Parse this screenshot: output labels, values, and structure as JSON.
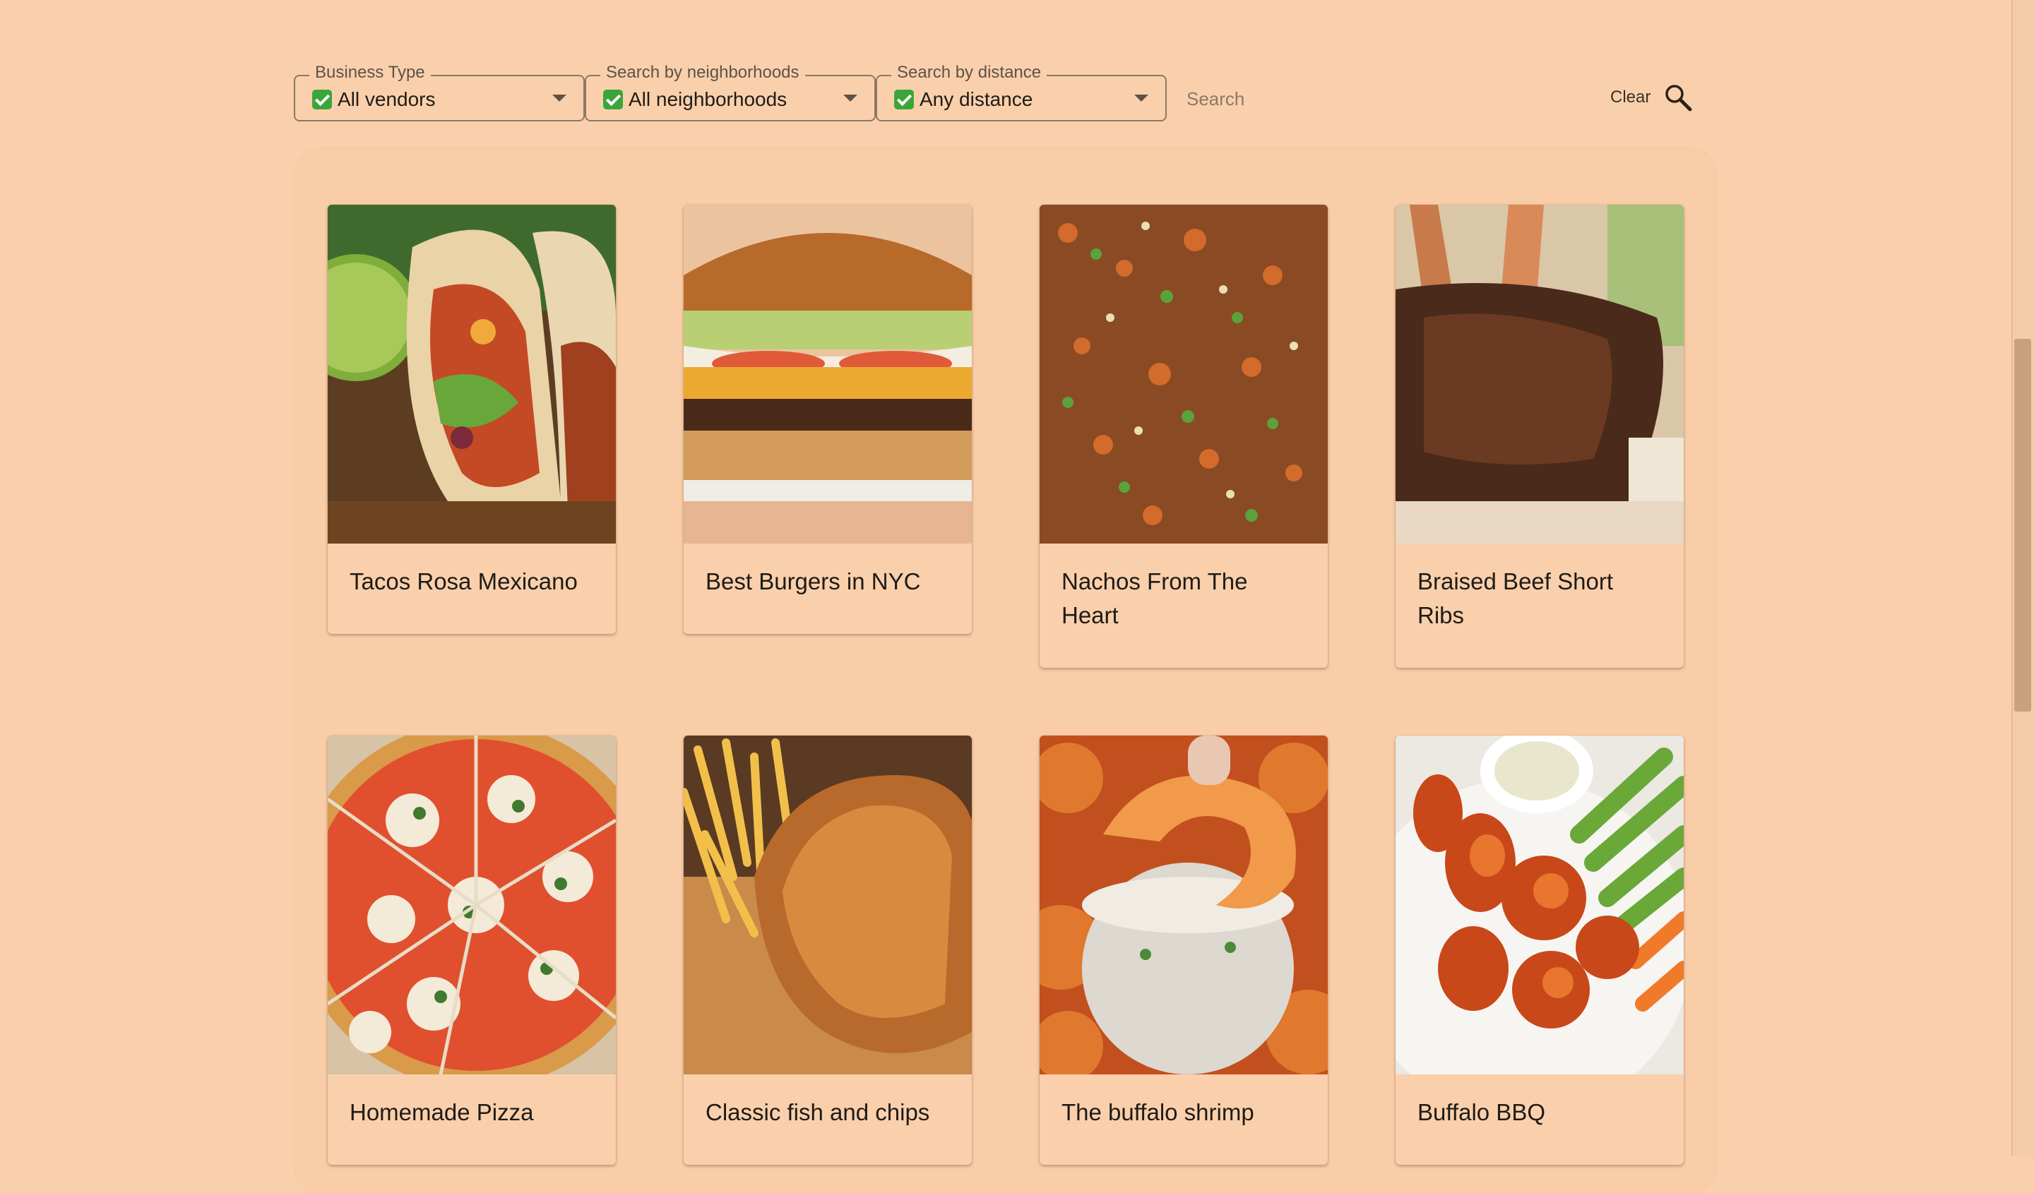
{
  "filters": {
    "business_type": {
      "legend": "Business Type",
      "value": "All vendors"
    },
    "neighborhoods": {
      "legend": "Search by neighborhoods",
      "value": "All neighborhoods"
    },
    "distance": {
      "legend": "Search by distance",
      "value": "Any distance"
    },
    "search_placeholder": "Search",
    "clear_label": "Clear"
  },
  "cards": [
    {
      "title": "Tacos Rosa Mexicano"
    },
    {
      "title": "Best Burgers in NYC"
    },
    {
      "title": "Nachos From The Heart"
    },
    {
      "title": "Braised Beef Short Ribs"
    },
    {
      "title": "Homemade Pizza"
    },
    {
      "title": "Classic fish and chips"
    },
    {
      "title": "The buffalo shrimp"
    },
    {
      "title": "Buffalo BBQ"
    }
  ]
}
